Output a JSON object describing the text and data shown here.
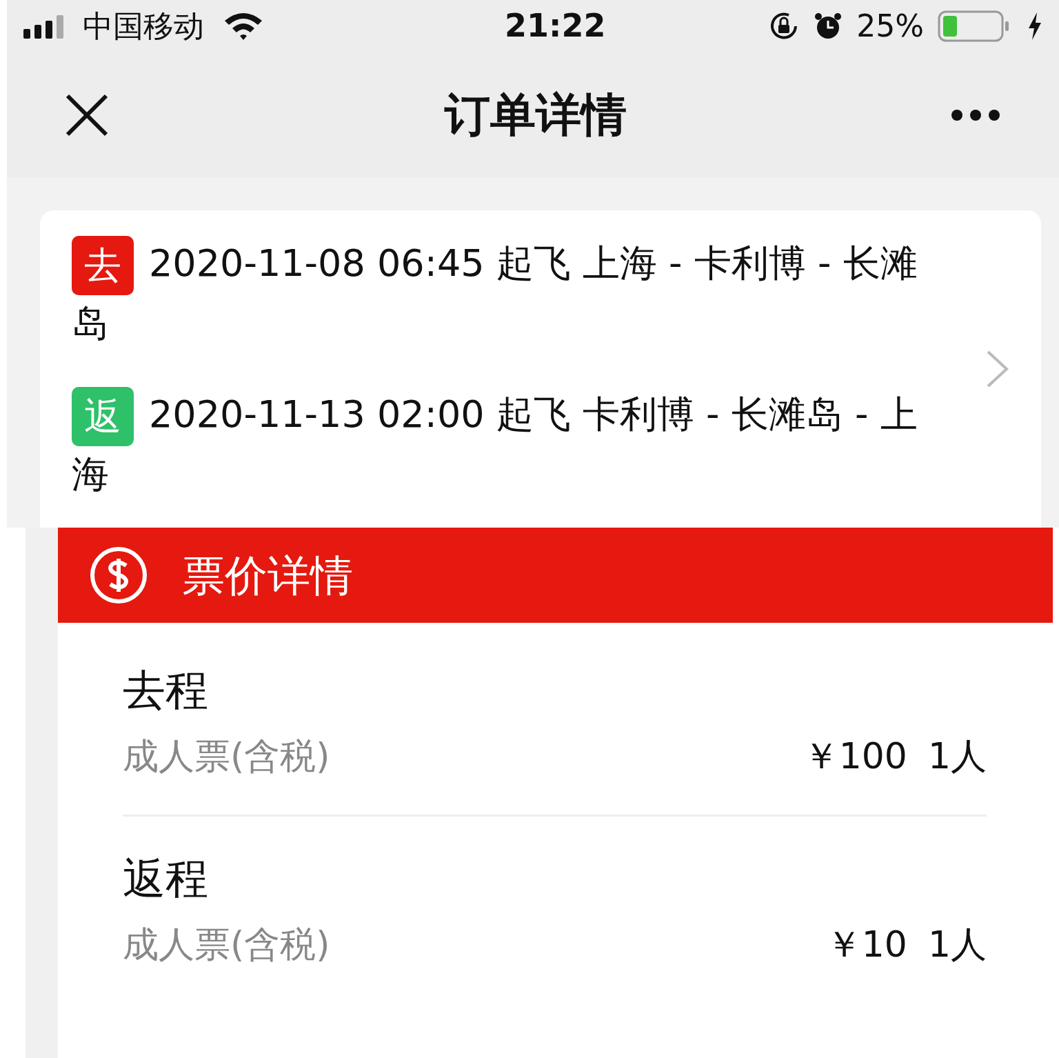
{
  "status_bar": {
    "carrier": "中国移动",
    "time": "21:22",
    "battery": "25%"
  },
  "nav": {
    "title": "订单详情"
  },
  "trips": [
    {
      "badge": "去",
      "color": "#e5190f",
      "text": "2020-11-08 06:45 起飞 上海 - 卡利博 - 长滩岛"
    },
    {
      "badge": "返",
      "color": "#2fc06a",
      "text": "2020-11-13 02:00 起飞 卡利博 - 长滩岛 - 上海"
    }
  ],
  "price_panel": {
    "title": "票价详情",
    "sections": [
      {
        "heading": "去程",
        "label": "成人票(含税)",
        "price": "￥100",
        "count": "1人"
      },
      {
        "heading": "返程",
        "label": "成人票(含税)",
        "price": "￥10",
        "count": "1人"
      }
    ]
  }
}
